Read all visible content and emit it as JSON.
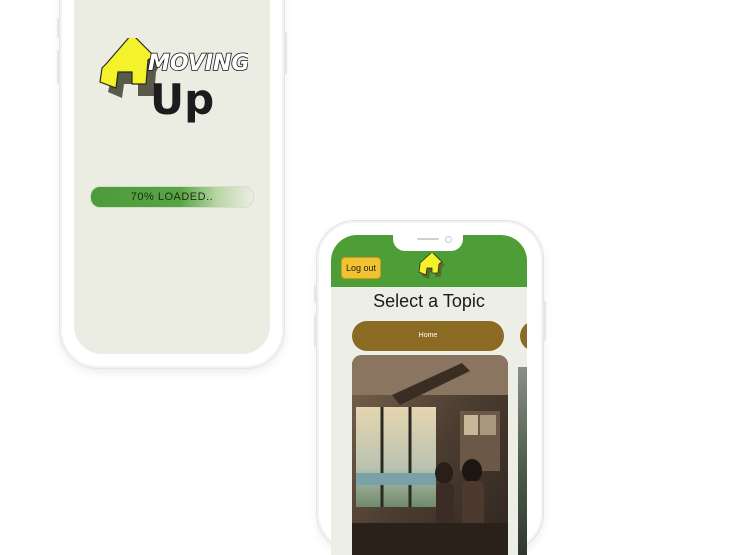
{
  "loading_screen": {
    "logo": {
      "word1": "MOVING",
      "word2": "Up"
    },
    "progress": {
      "label": "70% LOADED..",
      "fraction": 0.7
    }
  },
  "topic_screen": {
    "logout_label": "Log out",
    "title": "Select a Topic",
    "topics": [
      {
        "label": "Home"
      }
    ],
    "colors": {
      "header": "#4e9e37",
      "accent": "#f2c230",
      "topic_button": "#8b6a23",
      "arrow": "#f4f22a"
    },
    "icons": [
      "house-arrow-logo-icon"
    ]
  }
}
